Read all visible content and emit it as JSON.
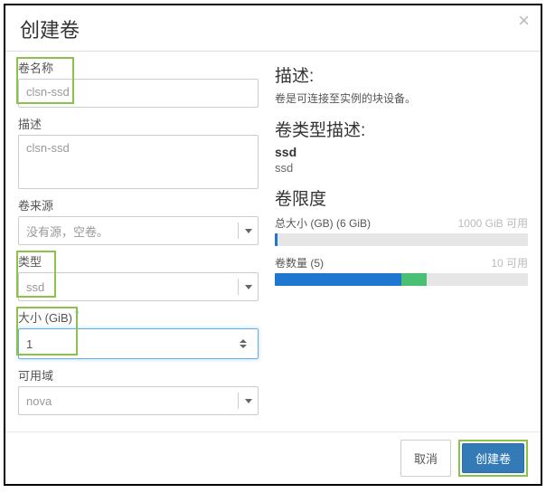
{
  "modal": {
    "title": "创建卷",
    "close": "×"
  },
  "form": {
    "name_label": "卷名称",
    "name_value": "clsn-ssd",
    "desc_label": "描述",
    "desc_value": "clsn-ssd",
    "source_label": "卷来源",
    "source_value": "没有源，空卷。",
    "type_label": "类型",
    "type_value": "ssd",
    "size_label": "大小 (GiB)",
    "size_value": "1",
    "az_label": "可用域",
    "az_value": "nova"
  },
  "right": {
    "desc_heading": "描述:",
    "desc_text": "卷是可连接至实例的块设备。",
    "type_heading": "卷类型描述:",
    "type_name": "ssd",
    "type_desc": "ssd",
    "limit_heading": "卷限度",
    "quota_size_label": "总大小 (GB) (6 GiB)",
    "quota_size_avail": "1000 GiB 可用",
    "quota_count_label": "卷数量 (5)",
    "quota_count_avail": "10 可用",
    "bar1_blue_pct": 1,
    "bar1_green_pct": 0,
    "bar2_blue_pct": 50,
    "bar2_green_pct": 10
  },
  "footer": {
    "cancel": "取消",
    "submit": "创建卷"
  }
}
